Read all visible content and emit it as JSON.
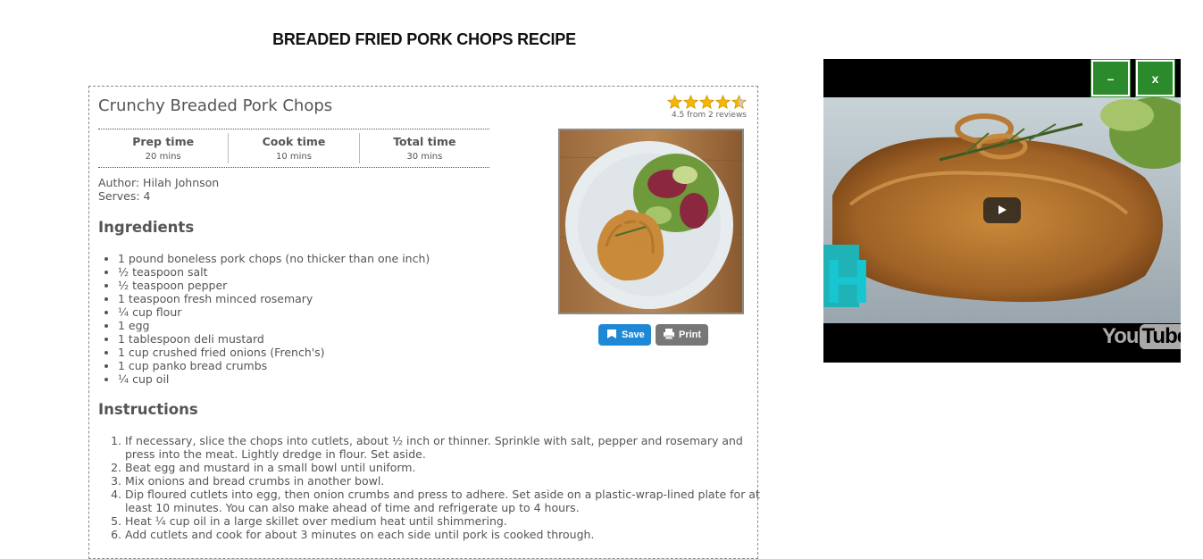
{
  "page": {
    "title": "BREADED FRIED PORK CHOPS RECIPE"
  },
  "recipe": {
    "name": "Crunchy Breaded Pork Chops",
    "rating": {
      "value": 4.5,
      "max": 5,
      "text": "4.5 from 2 reviews"
    },
    "times": [
      {
        "label": "Prep time",
        "value": "20 mins"
      },
      {
        "label": "Cook time",
        "value": "10 mins"
      },
      {
        "label": "Total time",
        "value": "30 mins"
      }
    ],
    "author": "Author: Hilah Johnson",
    "serves": "Serves: 4",
    "ingredients_heading": "Ingredients",
    "ingredients": [
      "1 pound boneless pork chops (no thicker than one inch)",
      "½ teaspoon salt",
      "½ teaspoon pepper",
      "1 teaspoon fresh minced rosemary",
      "¼ cup flour",
      "1 egg",
      "1 tablespoon deli mustard",
      "1 cup crushed fried onions (French's)",
      "1 cup panko bread crumbs",
      "¼ cup oil"
    ],
    "instructions_heading": "Instructions",
    "instructions": [
      "If necessary, slice the chops into cutlets, about ½ inch or thinner. Sprinkle with salt, pepper and rosemary and press into the meat. Lightly dredge in flour. Set aside.",
      "Beat egg and mustard in a small bowl until uniform.",
      "Mix onions and bread crumbs in another bowl.",
      "Dip floured cutlets into egg, then onion crumbs and press to adhere. Set aside on a plastic-wrap-lined plate for at least 10 minutes. You can also make ahead of time and refrigerate up to 4 hours.",
      "Heat ¼ cup oil in a large skillet over medium heat until shimmering.",
      "Add cutlets and cook for about 3 minutes on each side until pork is cooked through."
    ],
    "buttons": {
      "save": "Save",
      "print": "Print"
    }
  },
  "video": {
    "minimize_label": "–",
    "close_label": "x",
    "logo_you": "You",
    "logo_tube": "Tube",
    "overlay_letter": "H"
  },
  "colors": {
    "accent_green": "#2b8a2b",
    "save_blue": "#1e88d6",
    "star": "#f5b800"
  },
  "icons": [
    "star-icon",
    "save-icon",
    "printer-icon",
    "play-icon"
  ]
}
